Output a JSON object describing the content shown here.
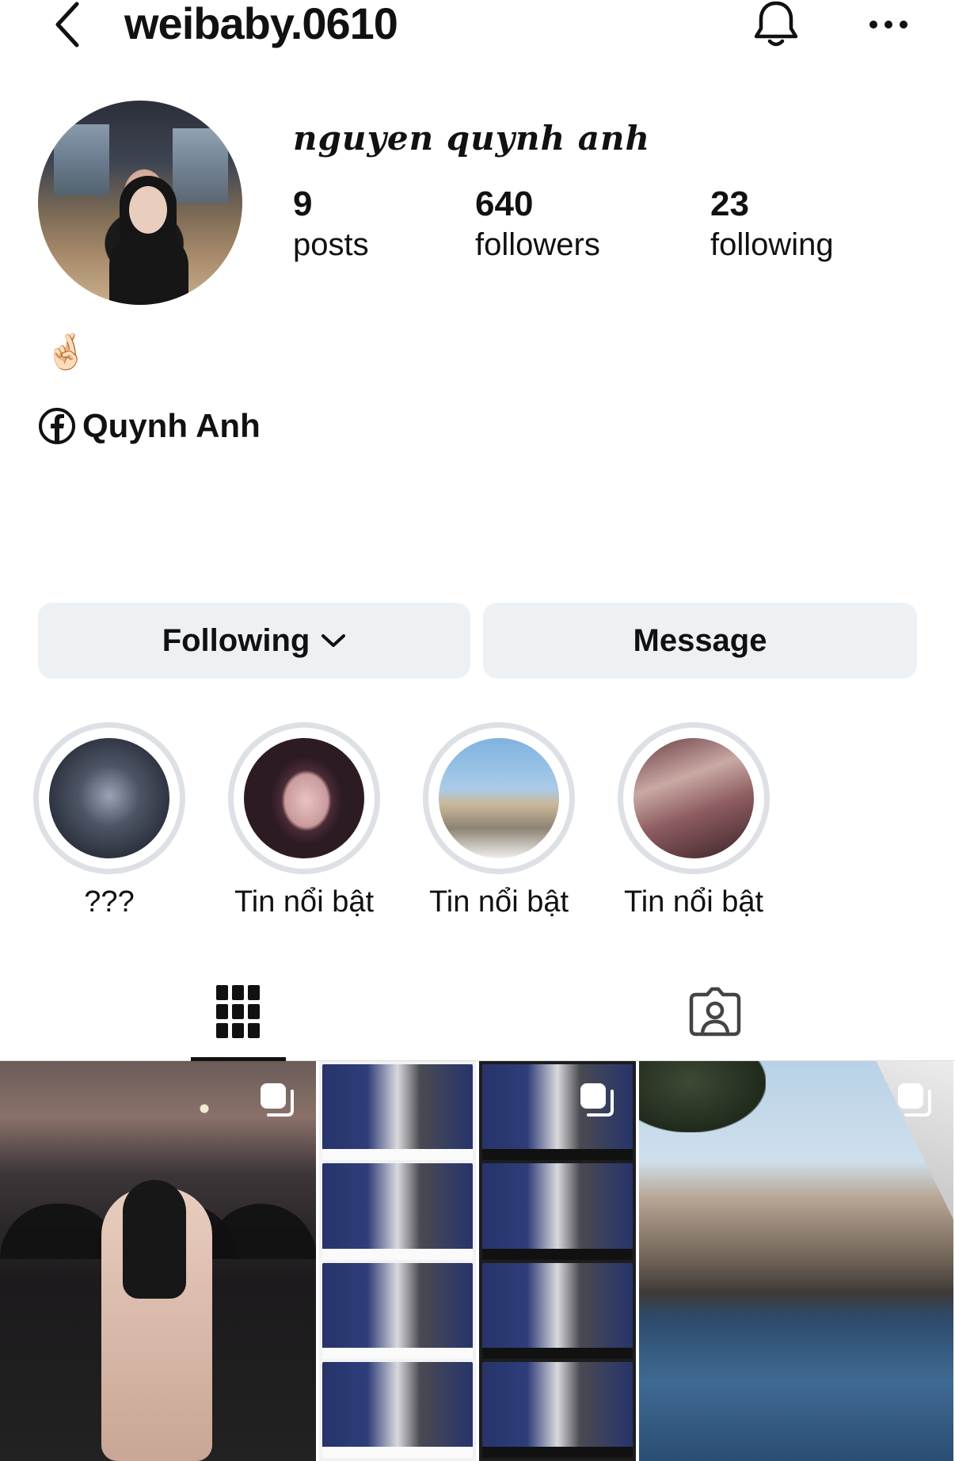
{
  "header": {
    "username": "weibaby.0610",
    "back_icon": "chevron-left-icon",
    "bell_icon": "bell-icon",
    "more_icon": "more-horizontal-icon"
  },
  "profile": {
    "display_name": "nguyen quynh anh",
    "stats": {
      "posts": {
        "value": "9",
        "label": "posts"
      },
      "followers": {
        "value": "640",
        "label": "followers"
      },
      "following": {
        "value": "23",
        "label": "following"
      }
    },
    "bio_emoji": "🤞🏻",
    "facebook": {
      "icon": "facebook-icon",
      "name": "Quynh Anh"
    }
  },
  "actions": {
    "following_label": "Following",
    "message_label": "Message"
  },
  "highlights": [
    {
      "label": "???"
    },
    {
      "label": "Tin nổi bật"
    },
    {
      "label": "Tin nổi bật"
    },
    {
      "label": "Tin nổi bật"
    }
  ],
  "tabs": [
    {
      "name": "posts-grid",
      "icon": "grid-icon",
      "active": true
    },
    {
      "name": "tagged",
      "icon": "tagged-person-icon",
      "active": false
    }
  ],
  "posts": [
    {
      "type": "carousel"
    },
    {
      "type": "photo-strip"
    },
    {
      "type": "carousel"
    },
    {
      "type": "carousel"
    }
  ],
  "colors": {
    "button_bg": "#eef1f4",
    "highlight_ring": "#dde0e4",
    "text": "#111111"
  }
}
